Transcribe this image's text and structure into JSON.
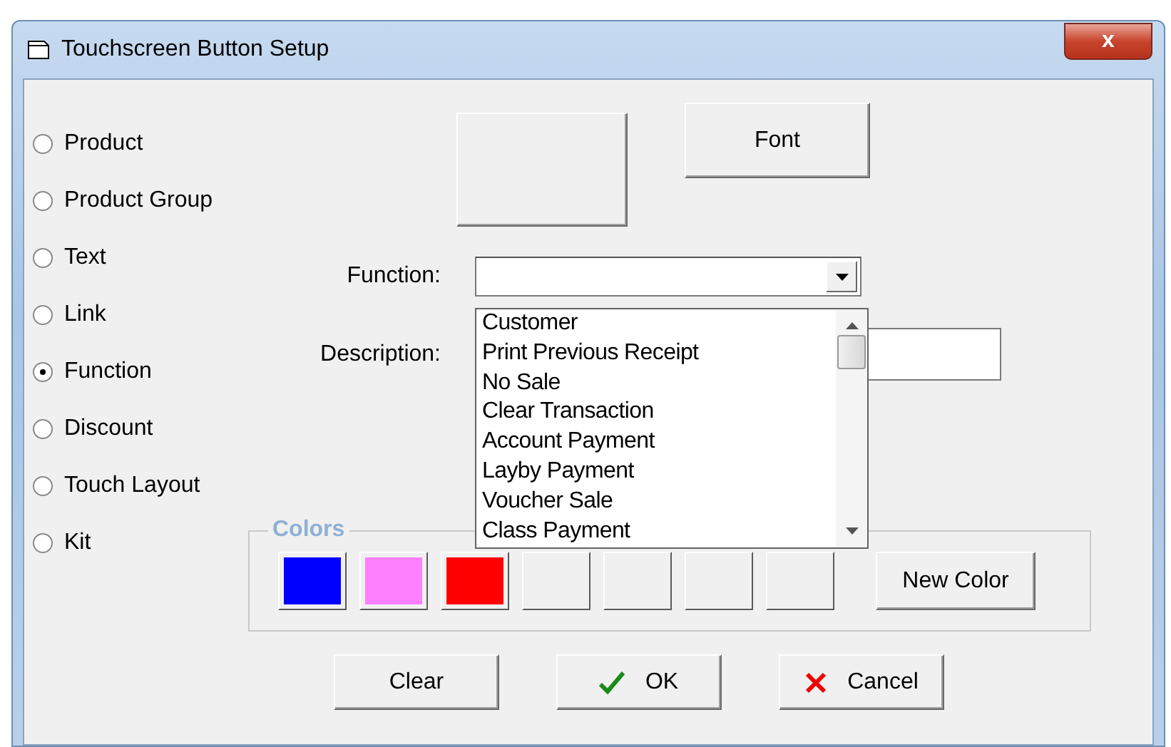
{
  "window": {
    "title": "Touchscreen Button Setup",
    "close": "x"
  },
  "button_types": [
    {
      "label": "Product",
      "selected": false
    },
    {
      "label": "Product Group",
      "selected": false
    },
    {
      "label": "Text",
      "selected": false
    },
    {
      "label": "Link",
      "selected": false
    },
    {
      "label": "Function",
      "selected": true
    },
    {
      "label": "Discount",
      "selected": false
    },
    {
      "label": "Touch Layout",
      "selected": false
    },
    {
      "label": "Kit",
      "selected": false
    }
  ],
  "font_button": "Font",
  "function": {
    "label": "Function:",
    "expanded": true,
    "options": [
      "Customer",
      "Print Previous Receipt",
      "No Sale",
      "Clear Transaction",
      "Account Payment",
      "Layby Payment",
      "Voucher Sale",
      "Class Payment"
    ]
  },
  "description": {
    "label": "Description:"
  },
  "colors": {
    "title": "Colors",
    "swatches": [
      {
        "kind": "color",
        "color": "#0000ff"
      },
      {
        "kind": "color",
        "color": "#ff80ff"
      },
      {
        "kind": "color",
        "color": "#ff0000"
      },
      {
        "kind": "empty"
      },
      {
        "kind": "empty"
      },
      {
        "kind": "empty"
      },
      {
        "kind": "empty"
      }
    ],
    "new_color": "New Color"
  },
  "buttons": [
    {
      "kind": "plain",
      "label": "Clear"
    },
    {
      "kind": "ok",
      "label": "OK"
    },
    {
      "kind": "cancel",
      "label": "Cancel"
    }
  ]
}
